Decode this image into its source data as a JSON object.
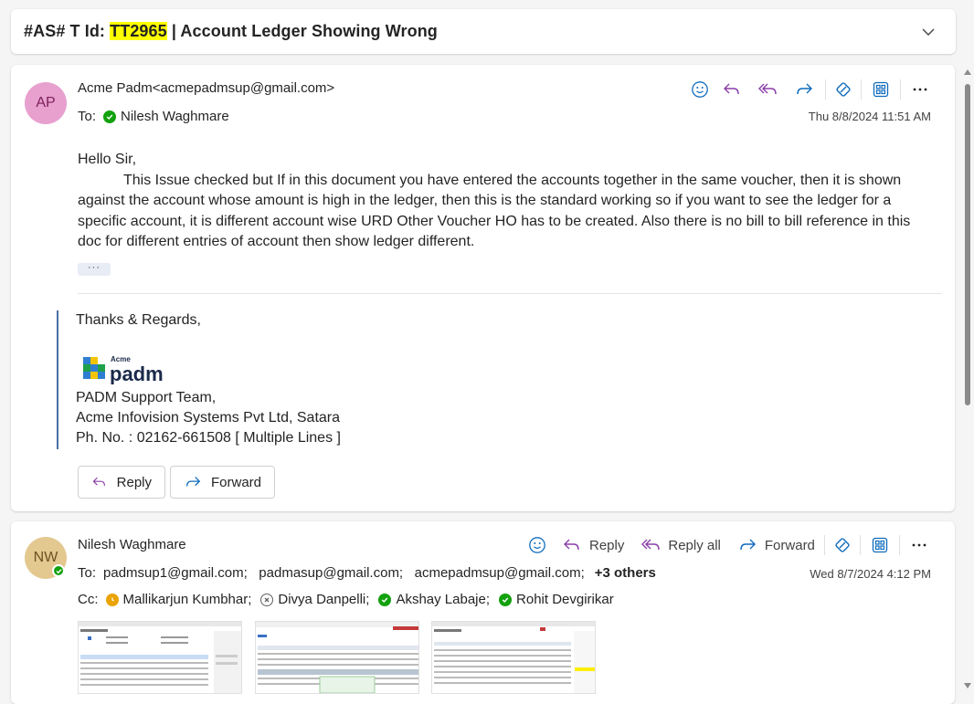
{
  "subject": {
    "prefix": "#AS# T Id: ",
    "ticket": "TT2965",
    "rest": " | Account Ledger Showing Wrong"
  },
  "message1": {
    "avatar_initials": "AP",
    "from": "Acme Padm<acmepadmsup@gmail.com>",
    "to_label": "To:",
    "to_name": "Nilesh Waghmare",
    "date": "Thu 8/8/2024 11:51 AM",
    "greeting": "Hello Sir,",
    "paragraph_a": "This Issue checked but If in this document you have entered the accounts together in the same voucher, then it is shown against the account whose amount is high in the ledger, then this is the standard working so if you want to see the ledger for a specific account, it is different account wise ",
    "paragraph_bold": "URD Other Voucher HO",
    "paragraph_b": " has to be created. Also there is no bill to bill reference in this doc for different entries of account then show ledger different.",
    "ellipsis": "···",
    "signature": {
      "thanks": "Thanks & Regards,",
      "logo_small": "Acme",
      "logo_big": "padm",
      "team": "PADM Support Team,",
      "company": "Acme Infovision Systems Pvt Ltd, Satara",
      "phone": "Ph. No. : 02162-661508 [ Multiple Lines ]"
    },
    "reply_label": "Reply",
    "forward_label": "Forward"
  },
  "message2": {
    "avatar_initials": "NW",
    "from": "Nilesh Waghmare",
    "to_label": "To:",
    "to_list": "padmsup1@gmail.com;   padmasup@gmail.com;   acmepadmsup@gmail.com;",
    "to_more": "+3 others",
    "cc_label": "Cc:",
    "cc": [
      {
        "name": "Mallikarjun Kumbhar;",
        "status": "away"
      },
      {
        "name": "Divya Danpelli;",
        "status": "offline"
      },
      {
        "name": "Akshay Labaje;",
        "status": "available"
      },
      {
        "name": "Rohit Devgirikar",
        "status": "available"
      }
    ],
    "date": "Wed 8/7/2024 4:12 PM",
    "reply_label": "Reply",
    "reply_all_label": "Reply all",
    "forward_label": "Forward"
  },
  "colors": {
    "accent": "#0f6cbd",
    "reply_purple": "#8b3fa8",
    "highlight": "#ffff00"
  }
}
